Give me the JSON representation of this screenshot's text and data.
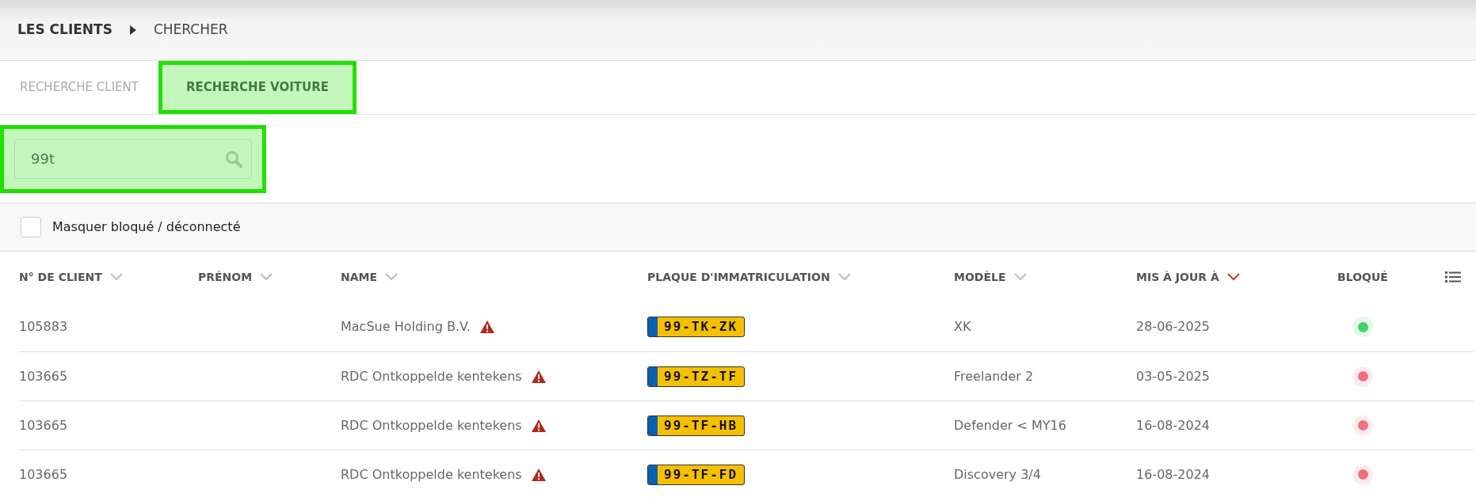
{
  "breadcrumb": [
    {
      "label": "LES CLIENTS",
      "current": false
    },
    {
      "label": "CHERCHER",
      "current": true
    }
  ],
  "tabs": [
    {
      "label": "RECHERCHE CLIENT",
      "selected": false,
      "highlighted": false
    },
    {
      "label": "RECHERCHE VOITURE",
      "selected": true,
      "highlighted": true
    }
  ],
  "search": {
    "value": "99t",
    "highlighted": true
  },
  "filter": {
    "label": "Masquer bloqué / déconnecté",
    "checked": false
  },
  "table": {
    "columns": [
      {
        "label": "N° DE CLIENT",
        "sorted": false
      },
      {
        "label": "PRÉNOM",
        "sorted": false
      },
      {
        "label": "NAME",
        "sorted": false
      },
      {
        "label": "PLAQUE D'IMMATRICULATION",
        "sorted": false
      },
      {
        "label": "MODÈLE",
        "sorted": false
      },
      {
        "label": "MIS À JOUR À",
        "sorted": true
      },
      {
        "label": "BLOQUÉ"
      }
    ],
    "rows": [
      {
        "client_no": "105883",
        "name": "MacSue Holding B.V.",
        "warning": true,
        "plate": "99-TK-ZK",
        "model": "XK",
        "updated": "28-06-2025",
        "blocked": false
      },
      {
        "client_no": "103665",
        "name": "RDC Ontkoppelde kentekens",
        "warning": true,
        "plate": "99-TZ-TF",
        "model": "Freelander 2",
        "updated": "03-05-2025",
        "blocked": true
      },
      {
        "client_no": "103665",
        "name": "RDC Ontkoppelde kentekens",
        "warning": true,
        "plate": "99-TF-HB",
        "model": "Defender < MY16",
        "updated": "16-08-2024",
        "blocked": true
      },
      {
        "client_no": "103665",
        "name": "RDC Ontkoppelde kentekens",
        "warning": true,
        "plate": "99-TF-FD",
        "model": "Discovery 3/4",
        "updated": "16-08-2024",
        "blocked": true
      }
    ]
  }
}
